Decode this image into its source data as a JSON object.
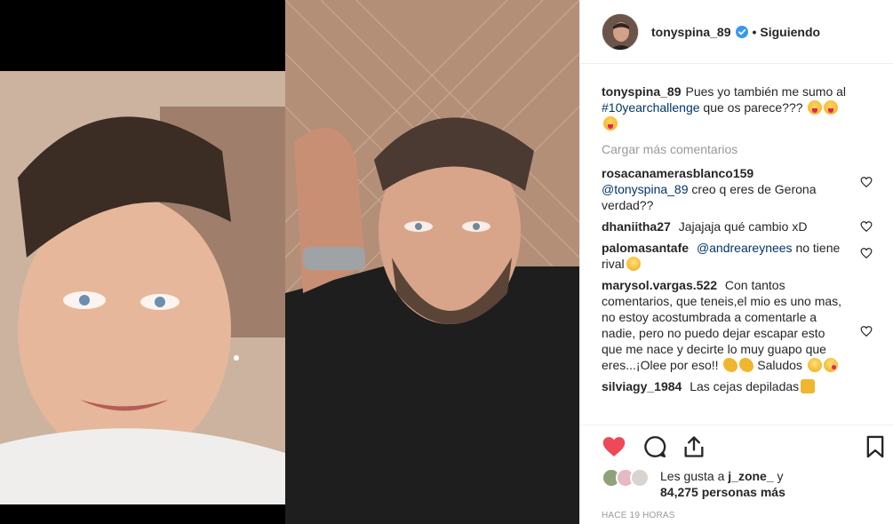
{
  "post": {
    "username": "tonyspina_89",
    "follow_label": "Siguiendo",
    "separator": "•",
    "verified": true,
    "caption": {
      "user": "tonyspina_89",
      "text_before": "Pues yo también me sumo al",
      "hashtag": "#10yearchallenge",
      "text_after": "que os parece???"
    }
  },
  "comments": {
    "load_more": "Cargar más comentarios",
    "items": [
      {
        "user": "rosacanamerasblanco159",
        "mention": "@tonyspina_89",
        "text": "creo q eres de Gerona verdad??"
      },
      {
        "user": "dhaniitha27",
        "text": "Jajajaja qué cambio xD"
      },
      {
        "user": "palomasantafe",
        "mention": "@andreareynees",
        "text": "no tiene rival"
      },
      {
        "user": "marysol.vargas.522",
        "text": "Con tantos comentarios, que teneis,el mio es uno mas, no estoy acostumbrada a comentarle a nadie, pero no puedo dejar escapar esto que me nace y decirte lo muy guapo que eres...¡Olee por eso!!",
        "text_end": "Saludos"
      },
      {
        "user": "silviagy_1984",
        "text": "Las cejas depiladas"
      }
    ]
  },
  "likes": {
    "prefix": "Les gusta a",
    "user": "j_zone_",
    "conj": "y",
    "count": "84,275",
    "suffix": "personas más"
  },
  "timestamp": "HACE 19 HORAS",
  "colors": {
    "like_red": "#ed4956",
    "link_blue": "#003569",
    "verified_blue": "#3897f0",
    "muted": "#999999"
  }
}
